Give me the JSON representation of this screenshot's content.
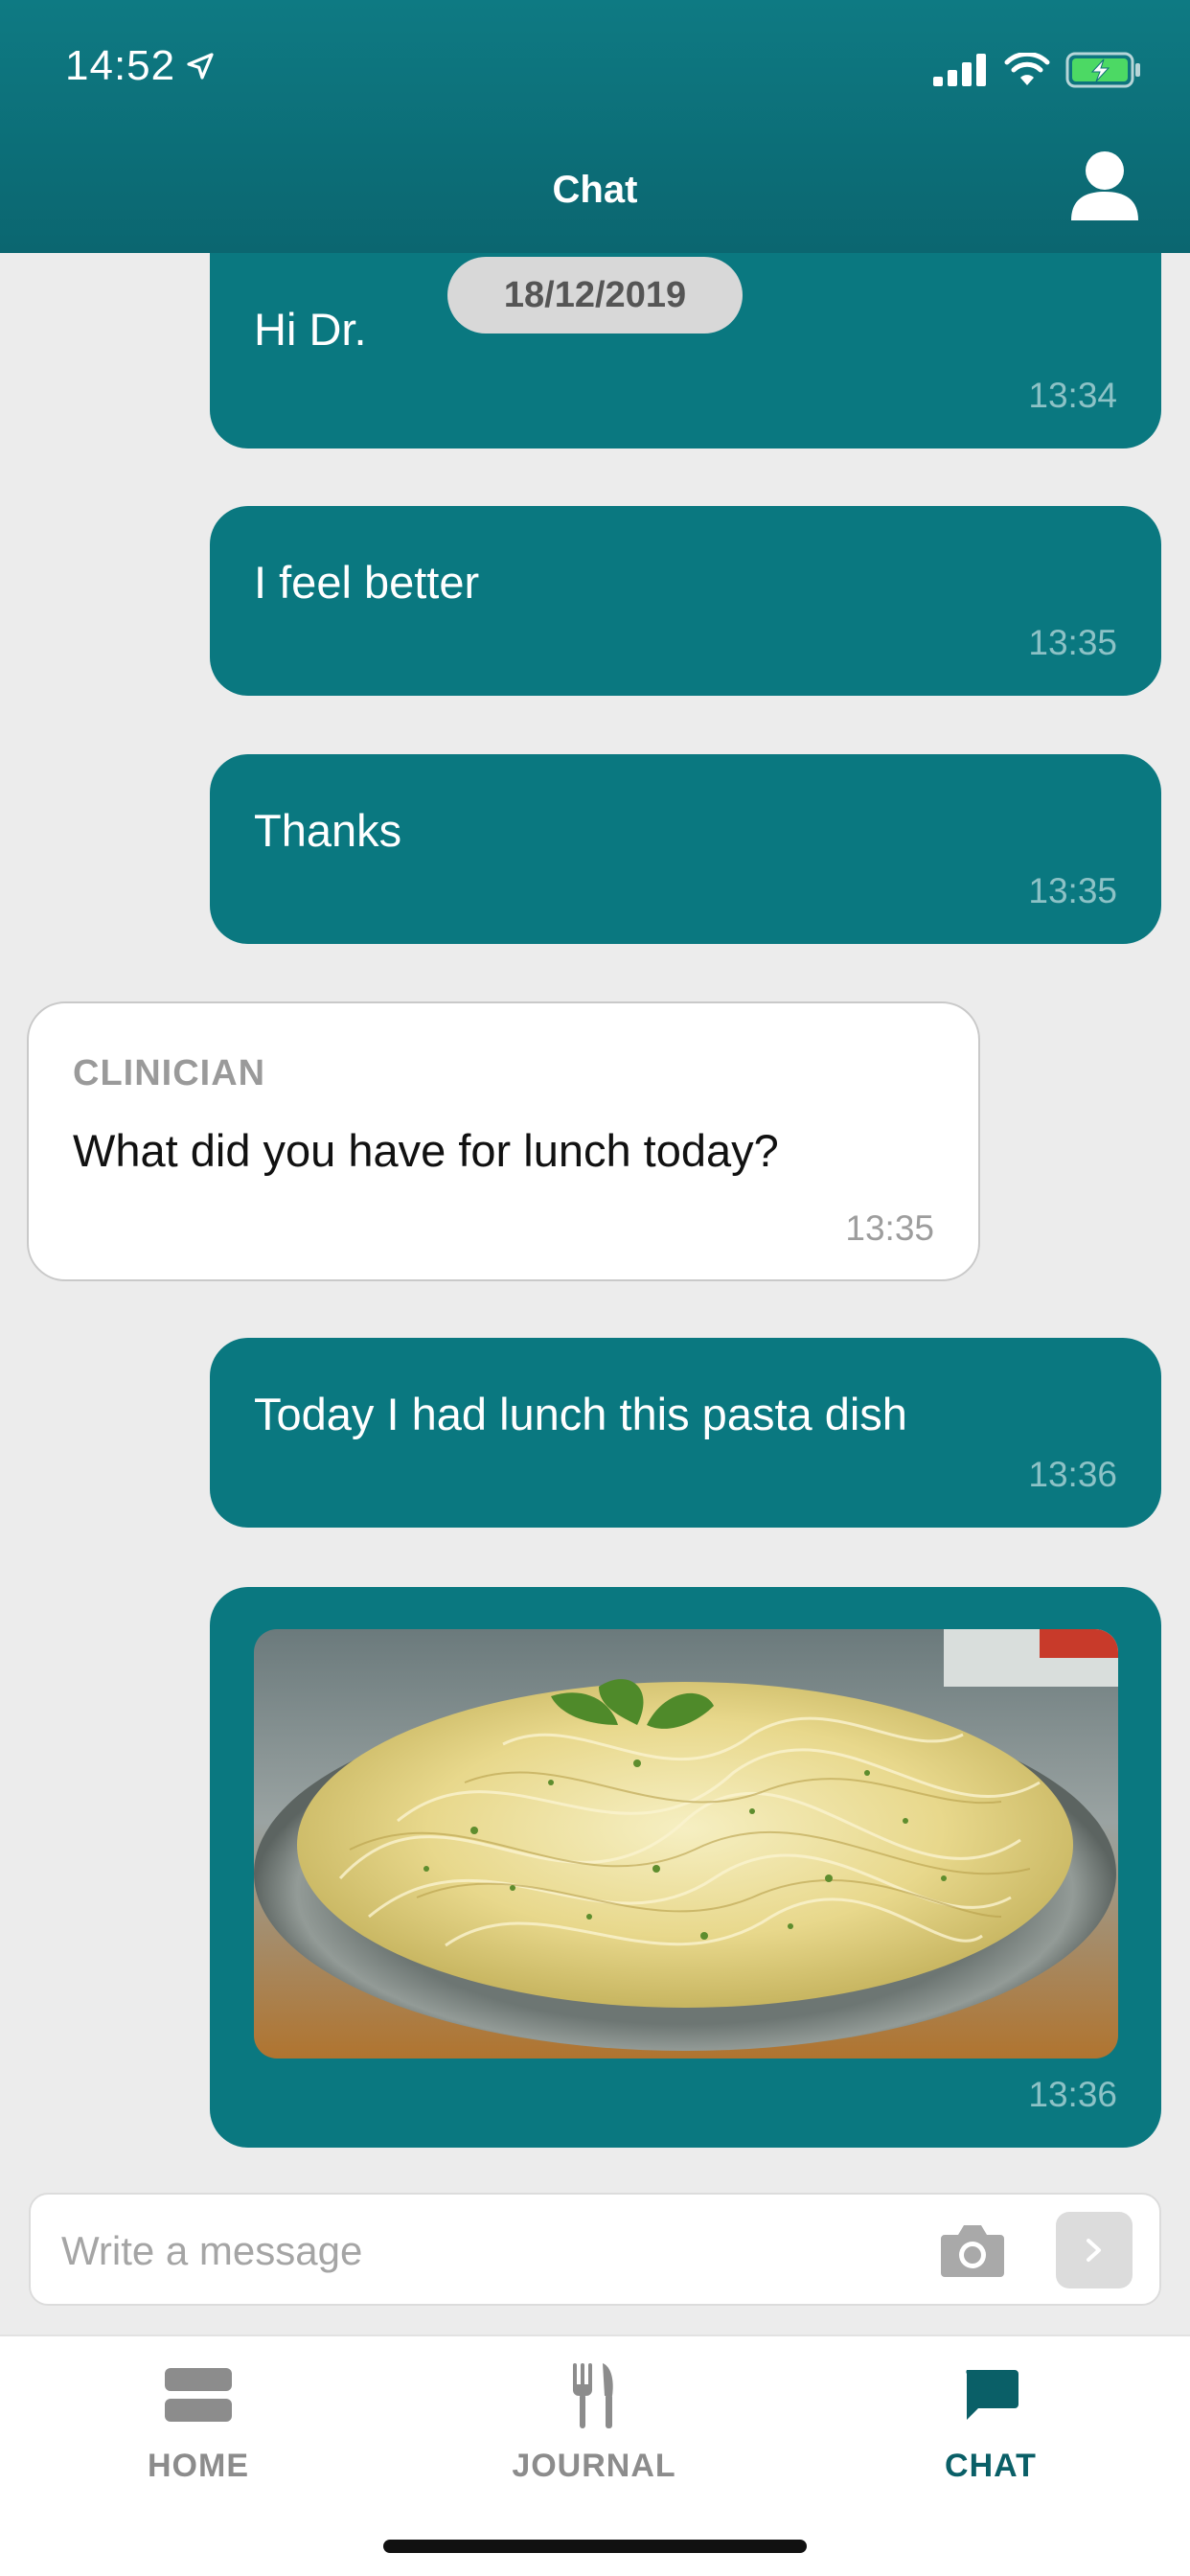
{
  "status_bar": {
    "time": "14:52"
  },
  "header": {
    "title": "Chat"
  },
  "date_separator": "18/12/2019",
  "messages": [
    {
      "direction": "outgoing",
      "text": "Hi Dr.",
      "time": "13:34"
    },
    {
      "direction": "outgoing",
      "text": "I feel better",
      "time": "13:35"
    },
    {
      "direction": "outgoing",
      "text": "Thanks",
      "time": "13:35"
    },
    {
      "direction": "incoming",
      "sender": "CLINICIAN",
      "text": "What did you have for lunch today?",
      "time": "13:35"
    },
    {
      "direction": "outgoing",
      "text": "Today I had lunch this pasta dish",
      "time": "13:36"
    },
    {
      "direction": "outgoing",
      "type": "image",
      "image": "pasta-dish-photo",
      "time": "13:36"
    }
  ],
  "composer": {
    "placeholder": "Write a message",
    "value": ""
  },
  "tabs": [
    {
      "label": "HOME",
      "icon": "home-icon",
      "active": false
    },
    {
      "label": "JOURNAL",
      "icon": "fork-knife-icon",
      "active": false
    },
    {
      "label": "CHAT",
      "icon": "chat-bubble-icon",
      "active": true
    }
  ],
  "colors": {
    "primary": "#0a7880",
    "header_top": "#0e7a83",
    "header_bottom": "#0b6670",
    "background": "#ececec",
    "tab_inactive": "#8c8c8c",
    "tab_active": "#0a5f67",
    "battery": "#4cd964"
  }
}
